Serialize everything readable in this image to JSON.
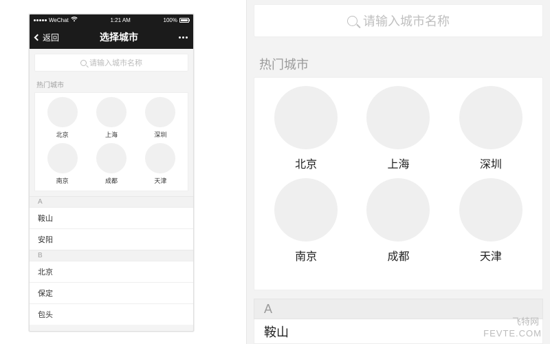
{
  "statusbar": {
    "carrier": "WeChat",
    "time": "1:21 AM",
    "battery": "100%"
  },
  "nav": {
    "back": "返回",
    "title": "选择城市"
  },
  "search": {
    "placeholder": "请输入城市名称"
  },
  "hot": {
    "title": "热门城市",
    "cities": [
      "北京",
      "上海",
      "深圳",
      "南京",
      "成都",
      "天津"
    ]
  },
  "index": [
    {
      "letter": "A",
      "items": [
        "鞍山",
        "安阳"
      ]
    },
    {
      "letter": "B",
      "items": [
        "北京",
        "保定",
        "包头"
      ]
    }
  ],
  "zoom_index_letter": "A",
  "zoom_index_item": "鞍山",
  "watermark": {
    "line1": "飞特网",
    "line2": "FEVTE.COM"
  }
}
